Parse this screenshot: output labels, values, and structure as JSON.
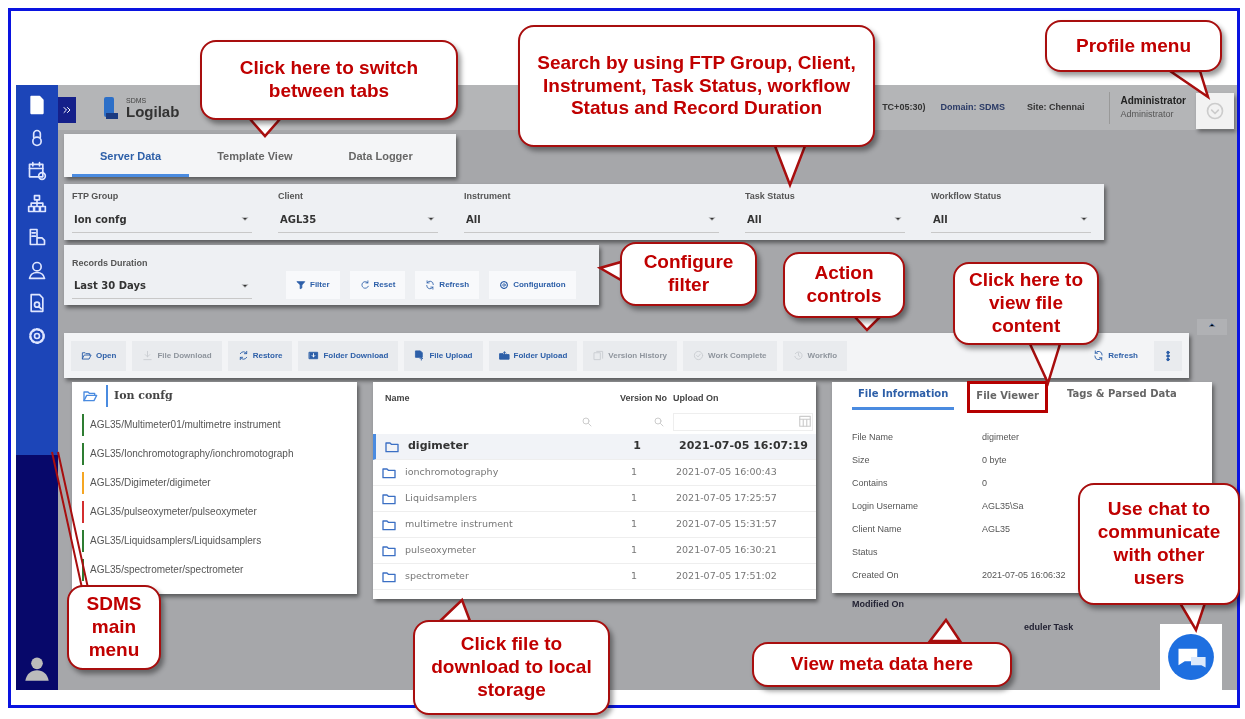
{
  "header": {
    "logo_caption": "SDMS",
    "logo": "Logilab",
    "timezone": "TC+05:30)",
    "domain": "Domain: SDMS",
    "site": "Site: Chennai",
    "user_name": "Administrator",
    "user_role": "Administrator"
  },
  "tabs": [
    {
      "label": "Server Data",
      "selected": true
    },
    {
      "label": "Template View",
      "selected": false
    },
    {
      "label": "Data Logger",
      "selected": false
    }
  ],
  "filters": [
    {
      "label": "FTP Group",
      "value": "Ion confg"
    },
    {
      "label": "Client",
      "value": "AGL35"
    },
    {
      "label": "Instrument",
      "value": "All"
    },
    {
      "label": "Task Status",
      "value": "All"
    },
    {
      "label": "Workflow Status",
      "value": "All"
    },
    {
      "label": "Records Duration",
      "value": "Last 30 Days"
    }
  ],
  "filter_buttons": [
    {
      "label": "Filter",
      "kind": "filter"
    },
    {
      "label": "Reset",
      "kind": "reset"
    },
    {
      "label": "Refresh",
      "kind": "refresh"
    },
    {
      "label": "Configuration",
      "kind": "settings"
    }
  ],
  "actions": [
    {
      "label": "Open",
      "kind": "open",
      "disabled": false
    },
    {
      "label": "File Download",
      "kind": "download",
      "disabled": true
    },
    {
      "label": "Restore",
      "kind": "restore",
      "disabled": false
    },
    {
      "label": "Folder Download",
      "kind": "folder-download",
      "disabled": false
    },
    {
      "label": "File Upload",
      "kind": "file-upload",
      "disabled": false
    },
    {
      "label": "Folder Upload",
      "kind": "folder-upload",
      "disabled": false
    },
    {
      "label": "Version History",
      "kind": "history",
      "disabled": true
    },
    {
      "label": "Work Complete",
      "kind": "complete",
      "disabled": true
    },
    {
      "label": "Workflo",
      "kind": "workflow",
      "disabled": true
    },
    {
      "label": "Refresh",
      "kind": "refresh",
      "disabled": false
    }
  ],
  "tree": {
    "root": "Ion confg",
    "items": [
      {
        "label": "AGL35/Multimeter01/multimetre instrument",
        "color": "#2e7d32"
      },
      {
        "label": "AGL35/Ionchromotography/ionchromotograph",
        "color": "#2e7d32"
      },
      {
        "label": "AGL35/Digimeter/digimeter",
        "color": "#f5a623"
      },
      {
        "label": "AGL35/pulseoxymeter/pulseoxymeter",
        "color": "#d32f2f"
      },
      {
        "label": "AGL35/Liquidsamplers/Liquidsamplers",
        "color": "#2e7d32"
      },
      {
        "label": "AGL35/spectrometer/spectrometer",
        "color": "#2e7d32"
      }
    ]
  },
  "table": {
    "columns": [
      "Name",
      "Version No",
      "Upload On"
    ],
    "rows": [
      {
        "name": "digimeter",
        "version": "1",
        "uploaded": "2021-07-05 16:07:19",
        "selected": true
      },
      {
        "name": "ionchromotography",
        "version": "1",
        "uploaded": "2021-07-05 16:00:43",
        "selected": false
      },
      {
        "name": "Liquidsamplers",
        "version": "1",
        "uploaded": "2021-07-05 17:25:57",
        "selected": false
      },
      {
        "name": "multimetre instrument",
        "version": "1",
        "uploaded": "2021-07-05 15:31:57",
        "selected": false
      },
      {
        "name": "pulseoxymeter",
        "version": "1",
        "uploaded": "2021-07-05 16:30:21",
        "selected": false
      },
      {
        "name": "spectrometer",
        "version": "1",
        "uploaded": "2021-07-05 17:51:02",
        "selected": false
      }
    ]
  },
  "file_info": {
    "tabs": [
      {
        "label": "File Information",
        "selected": true,
        "highlighted": false
      },
      {
        "label": "File Viewer",
        "selected": false,
        "highlighted": true
      },
      {
        "label": "Tags & Parsed Data",
        "selected": false,
        "highlighted": false
      }
    ],
    "rows": [
      {
        "label": "File Name",
        "value": "digimeter"
      },
      {
        "label": "Size",
        "value": "0 byte"
      },
      {
        "label": "Contains",
        "value": "0"
      },
      {
        "label": "Login Username",
        "value": "AGL35\\Sa"
      },
      {
        "label": "Client Name",
        "value": "AGL35"
      },
      {
        "label": "Status"
      },
      {
        "label": "Created On",
        "value": "2021-07-05 16:06:32"
      }
    ],
    "more_rows": [
      {
        "label": "Modified On"
      },
      {
        "value": "eduler Task"
      }
    ]
  },
  "callouts": [
    {
      "text": "Click here to switch between tabs"
    },
    {
      "text": "Search by using FTP Group, Client, Instrument, Task Status, workflow Status and Record Duration"
    },
    {
      "text": "Profile menu"
    },
    {
      "text": "Configure filter"
    },
    {
      "text": "Action controls"
    },
    {
      "text": "Click here to view file content"
    },
    {
      "text": "Use chat to communicate with other users"
    },
    {
      "text": "SDMS main menu"
    },
    {
      "text": "Click file to download to local storage"
    },
    {
      "text": "View meta data here"
    }
  ]
}
